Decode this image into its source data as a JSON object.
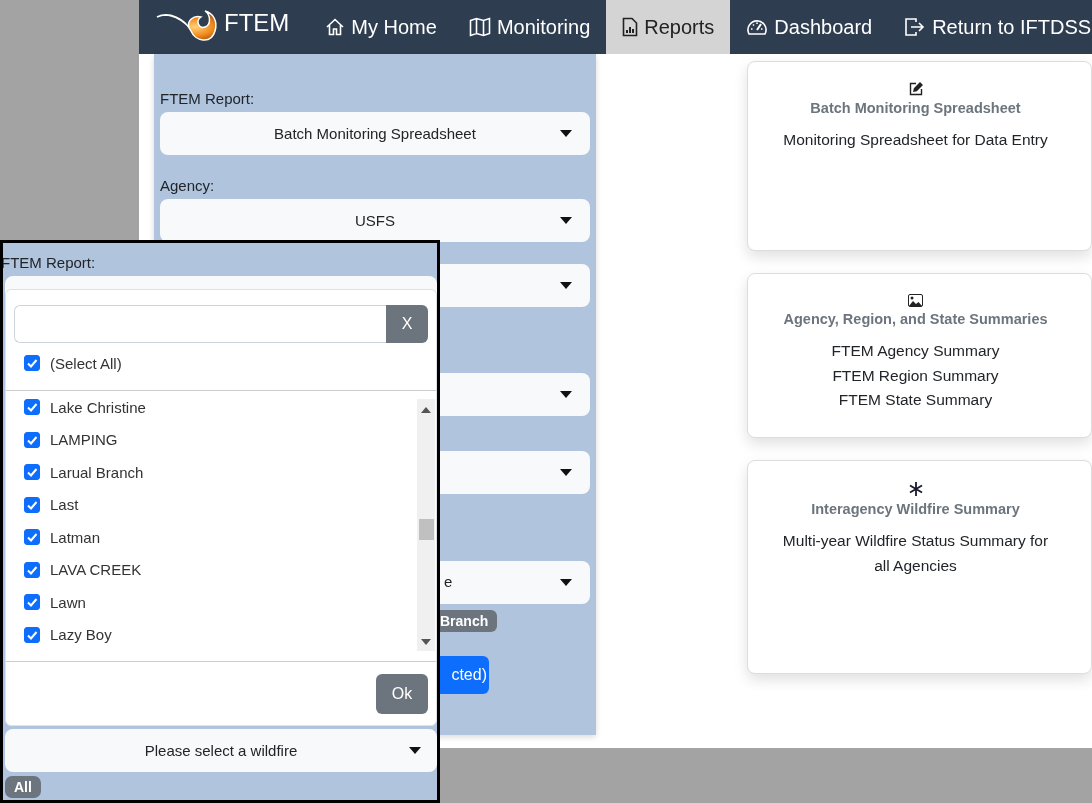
{
  "nav": {
    "brand": "FTEM",
    "items": [
      {
        "label": "My Home",
        "kind": "home",
        "selected": false
      },
      {
        "label": "Monitoring",
        "kind": "map",
        "selected": false
      },
      {
        "label": "Reports",
        "kind": "report",
        "selected": true
      },
      {
        "label": "Dashboard",
        "kind": "gauge",
        "selected": false
      },
      {
        "label": "Return to IFTDSS",
        "kind": "exit",
        "selected": false
      }
    ]
  },
  "form": {
    "fields": [
      {
        "label": "FTEM Report:",
        "value": "Batch Monitoring Spreadsheet"
      },
      {
        "label": "Agency:",
        "value": "USFS"
      }
    ],
    "covered_controls": [
      {
        "kind": "select"
      },
      {
        "kind": "select"
      },
      {
        "kind": "select"
      },
      {
        "kind": "select",
        "value": "e"
      },
      {
        "kind": "badge",
        "label": "Branch"
      },
      {
        "kind": "button",
        "label": "cted)"
      }
    ]
  },
  "cards": [
    {
      "kind": "edit",
      "title": "Batch Monitoring Spreadsheet",
      "lines": [
        "Monitoring Spreadsheet for Data Entry"
      ]
    },
    {
      "kind": "image",
      "title": "Agency, Region, and State Summaries",
      "lines": [
        "FTEM Agency Summary",
        "FTEM Region Summary",
        "FTEM State Summary"
      ]
    },
    {
      "kind": "asterisk",
      "title": "Interagency Wildfire Summary",
      "lines": [
        "Multi-year Wildfire Status Summary for all Agencies"
      ]
    }
  ],
  "dropdown_inset": {
    "label": "FTEM Report:",
    "clear_button": "X",
    "select_all": {
      "label": "(Select All)",
      "checked": true
    },
    "options": [
      {
        "label": "Lake Christine",
        "checked": true
      },
      {
        "label": "LAMPING",
        "checked": true
      },
      {
        "label": "Larual Branch",
        "checked": true
      },
      {
        "label": "Last",
        "checked": true
      },
      {
        "label": "Latman",
        "checked": true
      },
      {
        "label": "LAVA CREEK",
        "checked": true
      },
      {
        "label": "Lawn",
        "checked": true
      },
      {
        "label": "Lazy Boy",
        "checked": true
      }
    ],
    "ok_button": "Ok",
    "wildfire_select": {
      "value": "Please select a wildfire"
    },
    "badge": "All"
  }
}
